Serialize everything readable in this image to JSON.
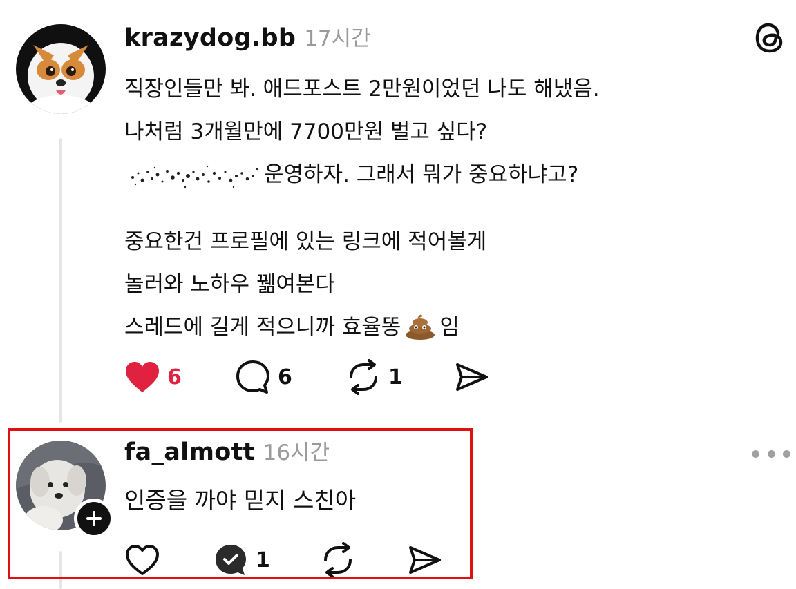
{
  "post": {
    "username": "krazydog.bb",
    "time": "17시간",
    "lines": [
      "직장인들만 봐. 애드포스트 2만원이었던 나도 해냈음.",
      "나처럼 3개월만에 7700만원 벌고 싶다?",
      "운영하자. 그래서 뭐가 중요하냐고?",
      "",
      "중요한건 프로필에 있는 링크에 적어볼게",
      "놀러와 노하우 꿺여본다",
      "스레드에 길게 적으니까 효율똥",
      "임"
    ],
    "emoji": "poop",
    "likes": "6",
    "comments": "6",
    "reposts": "1"
  },
  "reply": {
    "username": "fa_almott",
    "time": "16시간",
    "text": "인증을 까야 믿지 스친아",
    "comments": "1"
  },
  "icons": {
    "app_logo": "threads-logo-icon",
    "like_active": "heart-filled-icon",
    "like": "heart-outline-icon",
    "comment": "comment-bubble-icon",
    "comment_checked": "comment-check-icon",
    "repost": "repost-icon",
    "share": "send-icon",
    "more": "more-horizontal-icon",
    "follow": "plus-icon"
  },
  "colors": {
    "like_red": "#e0213f",
    "timestamp_gray": "#9a9a9a",
    "highlight_red": "#e01010"
  }
}
